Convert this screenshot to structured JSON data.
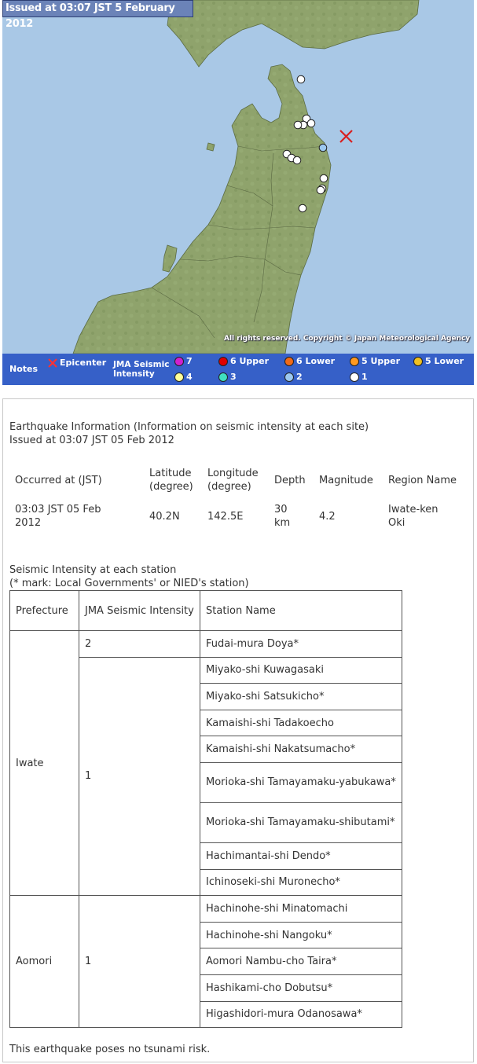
{
  "map": {
    "issued_banner": "Issued at 03:07 JST  5 February 2012",
    "copyright": "All rights reserved. Copyright © Japan Meteorological Agency",
    "colors": {
      "sea": "#a9c8e6",
      "land": "#8fa36c",
      "epicenter": "#d82020",
      "legend_bg": "#3660c8",
      "intensity_2": "#9cc8f0",
      "intensity_1": "#ffffff"
    },
    "epicenter_icon": "x-mark-icon",
    "station_icon": "circle-icon"
  },
  "legend": {
    "notes": "Notes",
    "epicenter": "Epicenter",
    "jma_line1": "JMA Seismic",
    "jma_line2": "Intensity",
    "items": [
      {
        "label": "7",
        "color": "#d020d0"
      },
      {
        "label": "6 Upper",
        "color": "#e00000"
      },
      {
        "label": "6 Lower",
        "color": "#f06a18"
      },
      {
        "label": "5 Upper",
        "color": "#ff9a20"
      },
      {
        "label": "5 Lower",
        "color": "#f0c020"
      },
      {
        "label": "4",
        "color": "#ffff99"
      },
      {
        "label": "3",
        "color": "#40e0c0"
      },
      {
        "label": "2",
        "color": "#9cc8f0"
      },
      {
        "label": "1",
        "color": "#ffffff"
      }
    ]
  },
  "info": {
    "title_line1": "Earthquake Information (Information on seismic intensity at each site)",
    "title_line2": "Issued at 03:07 JST 05 Feb 2012",
    "headers": {
      "occurred": "Occurred at (JST)",
      "latitude": "Latitude (degree)",
      "longitude": "Longitude (degree)",
      "depth": "Depth",
      "magnitude": "Magnitude",
      "region": "Region Name"
    },
    "values": {
      "occurred": "03:03 JST 05 Feb 2012",
      "latitude": "40.2N",
      "longitude": "142.5E",
      "depth": "30 km",
      "magnitude": "4.2",
      "region": "Iwate-ken Oki"
    }
  },
  "stations": {
    "title_line1": "Seismic Intensity at each station",
    "title_line2": "(* mark: Local Governments' or NIED's station)",
    "headers": {
      "prefecture": "Prefecture",
      "intensity": "JMA Seismic Intensity",
      "station": "Station Name"
    },
    "iwate": {
      "prefecture": "Iwate",
      "int2": "2",
      "int2_stations": [
        "Fudai-mura Doya*"
      ],
      "int1": "1",
      "int1_stations": [
        "Miyako-shi Kuwagasaki",
        "Miyako-shi Satsukicho*",
        "Kamaishi-shi Tadakoecho",
        "Kamaishi-shi Nakatsumacho*",
        "Morioka-shi Tamayamaku-yabukawa*",
        "Morioka-shi Tamayamaku-shibutami*",
        "Hachimantai-shi Dendo*",
        "Ichinoseki-shi Muronecho*"
      ]
    },
    "aomori": {
      "prefecture": "Aomori",
      "int1": "1",
      "int1_stations": [
        "Hachinohe-shi Minatomachi",
        "Hachinohe-shi Nangoku*",
        "Aomori Nambu-cho Taira*",
        "Hashikami-cho Dobutsu*",
        "Higashidori-mura Odanosawa*"
      ]
    }
  },
  "footer": {
    "tsunami": "This earthquake poses no tsunami risk."
  }
}
